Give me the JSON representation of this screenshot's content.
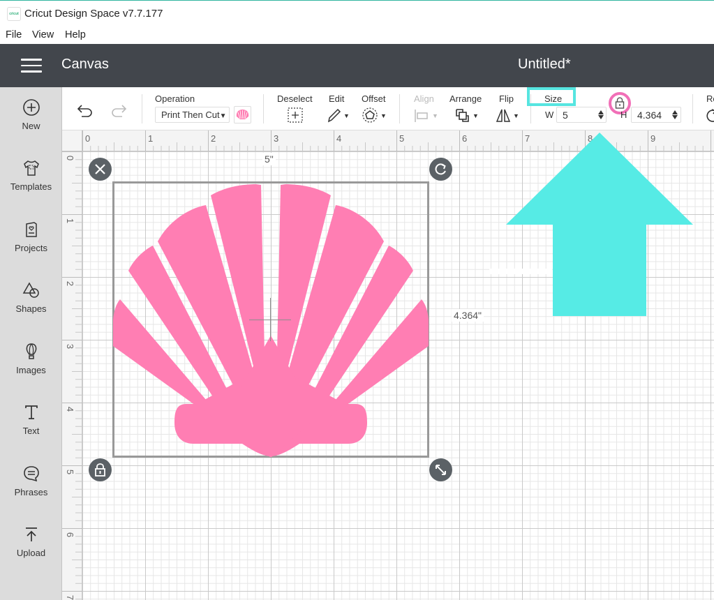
{
  "window": {
    "app_title": "Cricut Design Space  v7.7.177",
    "logo_text": "cricut",
    "menu": [
      "File",
      "View",
      "Help"
    ]
  },
  "header": {
    "section_title": "Canvas",
    "document_title": "Untitled*"
  },
  "sidebar": {
    "items": [
      {
        "label": "New",
        "icon": "plus-circle-icon"
      },
      {
        "label": "Templates",
        "icon": "tshirt-icon"
      },
      {
        "label": "Projects",
        "icon": "card-heart-icon"
      },
      {
        "label": "Shapes",
        "icon": "shapes-icon"
      },
      {
        "label": "Images",
        "icon": "balloon-icon"
      },
      {
        "label": "Text",
        "icon": "text-t-icon"
      },
      {
        "label": "Phrases",
        "icon": "speech-bubble-icon"
      },
      {
        "label": "Upload",
        "icon": "upload-icon"
      }
    ]
  },
  "toolbar": {
    "operation_label": "Operation",
    "operation_value": "Print Then Cut",
    "deselect_label": "Deselect",
    "edit_label": "Edit",
    "offset_label": "Offset",
    "align_label": "Align",
    "arrange_label": "Arrange",
    "flip_label": "Flip",
    "size_label": "Size",
    "width_letter": "W",
    "width_value": "5",
    "height_letter": "H",
    "height_value": "4.364",
    "rotate_label_partial": "Ro",
    "colors": {
      "highlight_cyan": "#56e5e0",
      "highlight_pink": "#f16fb7"
    }
  },
  "canvas": {
    "ruler_top": [
      "0",
      "1",
      "2",
      "3",
      "4",
      "5",
      "6",
      "7",
      "8",
      "9"
    ],
    "ruler_left": [
      "0",
      "1",
      "2",
      "3",
      "4",
      "5",
      "6",
      "7"
    ],
    "width_dim_label": "5\"",
    "height_dim_label": "4.364\"",
    "shape_color": "#ff7eb3",
    "arrow_color": "#56ebe5"
  }
}
